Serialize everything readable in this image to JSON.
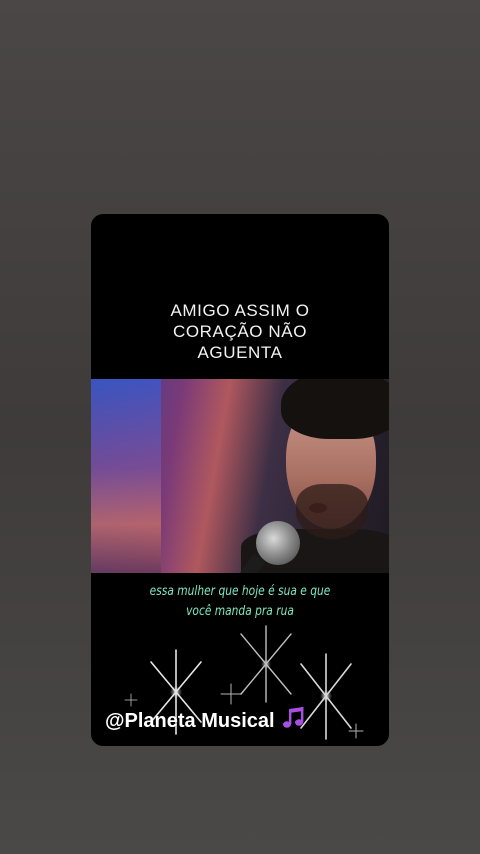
{
  "story": {
    "headline": "AMIGO ASSIM O\nCORAÇÃO NÃO\nAGUENTA",
    "lyrics": "essa mulher que hoje é sua e que\nvocê manda pra rua",
    "watermark": "@Planeta Musical",
    "watermark_icon": "musical-notes-icon"
  },
  "colors": {
    "background": "#464342",
    "card": "#000000",
    "headline_text": "#f2f2f2",
    "lyrics_text": "#7fe6c4",
    "watermark_text": "#ffffff",
    "note_icon": "#a64fe0"
  }
}
